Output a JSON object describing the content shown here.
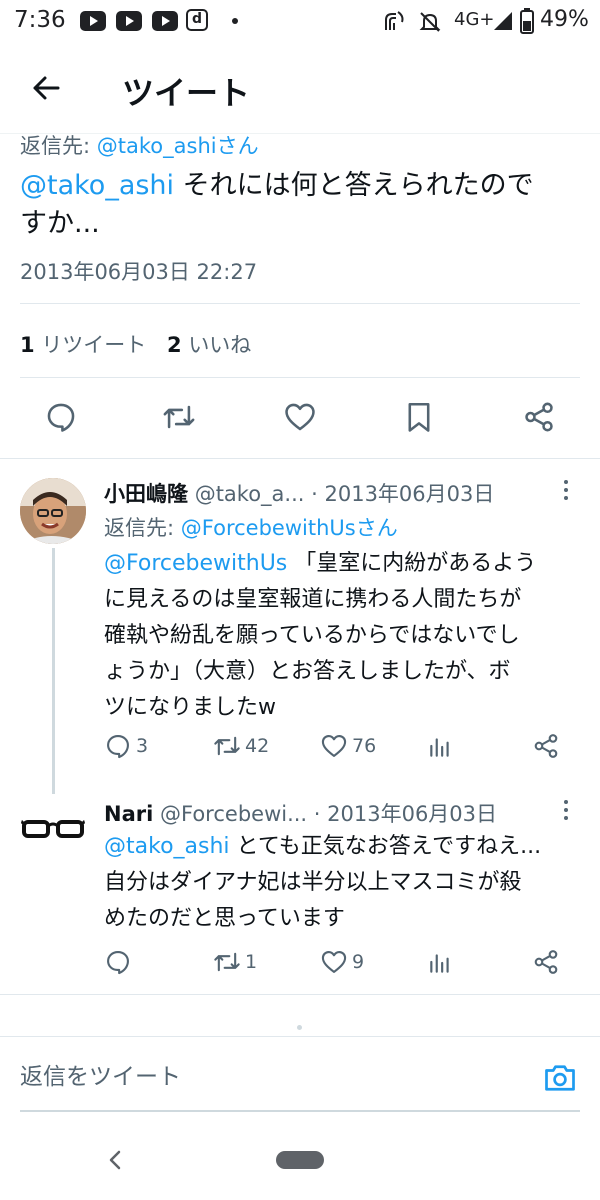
{
  "status_bar": {
    "time": "7:36",
    "network": "4G+",
    "battery": "49%"
  },
  "header": {
    "title": "ツイート"
  },
  "main_tweet": {
    "reply_prefix": "返信先: ",
    "reply_to": "@tako_ashiさん",
    "mention": "@tako_ashi",
    "text_line1": " それには何と答えられたので",
    "text_line2": "すか...",
    "datetime": "2013年06月03日 22:27",
    "retweets_count": "1",
    "retweets_label": "リツイート",
    "likes_count": "2",
    "likes_label": "いいね"
  },
  "replies": [
    {
      "name": "小田嶋隆",
      "handle": "@tako_a...",
      "date": "· 2013年06月03日",
      "reply_prefix": "返信先: ",
      "reply_to": "@ForcebewithUsさん",
      "mention": "@ForcebewithUs",
      "line1_rest": " 「皇室に内紛があるよう",
      "line2": "に見えるのは皇室報道に携わる人間たちが",
      "line3": "確執や紛乱を願っているからではないでし",
      "line4": "ょうか」（大意）とお答えしましたが、ボ",
      "line5": "ツになりましたw",
      "replies": "3",
      "retweets": "42",
      "likes": "76"
    },
    {
      "name": "Nari",
      "handle": "@Forcebewi...",
      "date": "· 2013年06月03日",
      "mention": "@tako_ashi",
      "line1_rest": " とても正気なお答えですねえ...",
      "line2": "自分はダイアナ妃は半分以上マスコミが殺",
      "line3": "めたのだと思っています",
      "replies": "",
      "retweets": "1",
      "likes": "9"
    }
  ],
  "compose": {
    "placeholder": "返信をツイート"
  },
  "colors": {
    "accent": "#1d9bf0",
    "text": "#0f1419",
    "secondary": "#536471"
  }
}
